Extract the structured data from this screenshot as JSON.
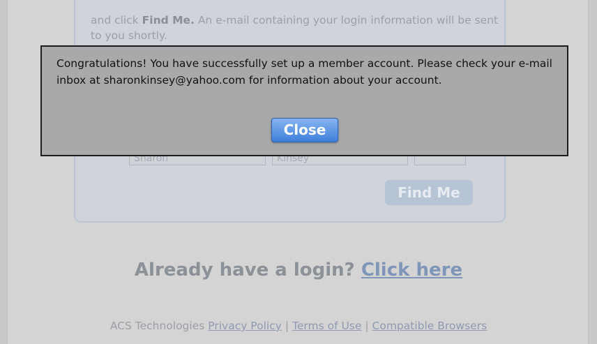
{
  "instructions": {
    "prefix": "and click",
    "bold": "Find Me.",
    "suffix": "An e-mail containing your login information will be sent to you shortly."
  },
  "form": {
    "first_name": "Sharon",
    "last_name": "Kinsey",
    "third": "",
    "find_button": "Find Me"
  },
  "login_prompt": {
    "text": "Already have a login?",
    "link": "Click here"
  },
  "footer": {
    "company": "ACS Technologies",
    "privacy": "Privacy Policy",
    "sep1": "|",
    "terms": "Terms of Use",
    "sep2": "|",
    "browsers": "Compatible Browsers"
  },
  "modal": {
    "message": "Congratulations! You have successfully set up a member account. Please check your e-mail inbox at sharonkinsey@yahoo.com for information about your account.",
    "close_label": "Close"
  }
}
